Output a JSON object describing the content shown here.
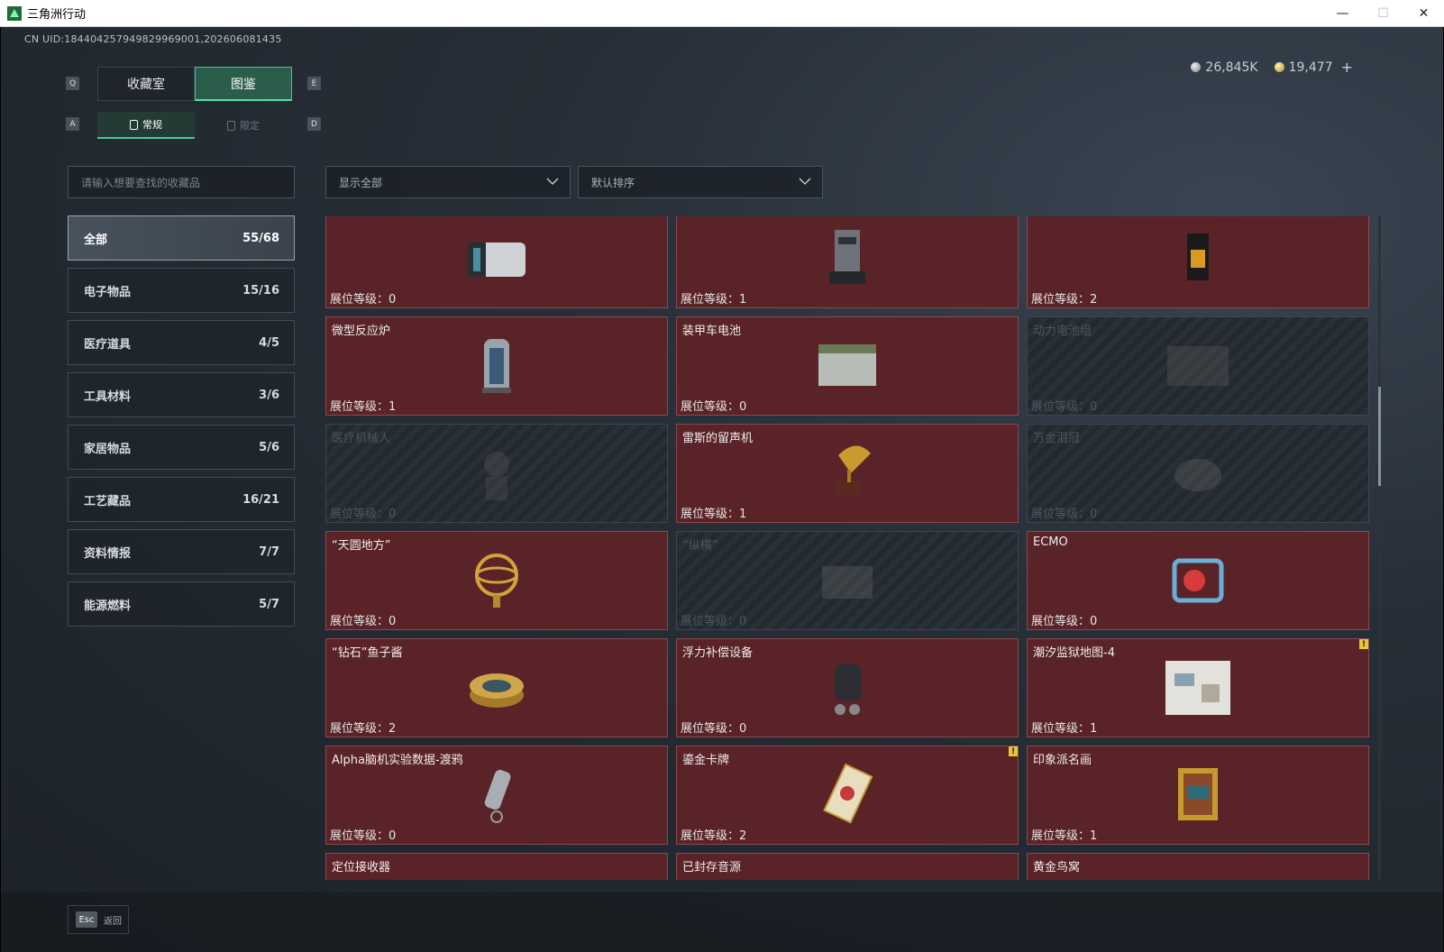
{
  "window": {
    "title": "三角洲行动",
    "minimize": "—",
    "maximize": "☐",
    "close": "✕"
  },
  "uid": "CN UID:184404257949829969001,202606081435",
  "currency": {
    "silver": "26,845K",
    "gold": "19,477",
    "plus": "+"
  },
  "keys": {
    "prev_tab": "Q",
    "next_tab": "E",
    "prev_sub": "A",
    "next_sub": "D"
  },
  "tabs_primary": [
    {
      "label": "收藏室",
      "active": false
    },
    {
      "label": "图鉴",
      "active": true
    }
  ],
  "tabs_secondary": [
    {
      "label": "常规",
      "active": true
    },
    {
      "label": "限定",
      "active": false
    }
  ],
  "search": {
    "placeholder": "请输入想要查找的收藏品"
  },
  "filter": {
    "value": "显示全部"
  },
  "sort": {
    "value": "默认排序"
  },
  "categories": [
    {
      "label": "全部",
      "count": "55/68",
      "active": true
    },
    {
      "label": "电子物品",
      "count": "15/16"
    },
    {
      "label": "医疗道具",
      "count": "4/5"
    },
    {
      "label": "工具材料",
      "count": "3/6"
    },
    {
      "label": "家居物品",
      "count": "5/6"
    },
    {
      "label": "工艺藏品",
      "count": "16/21"
    },
    {
      "label": "资料情报",
      "count": "7/7"
    },
    {
      "label": "能源燃料",
      "count": "5/7"
    }
  ],
  "level_prefix": "展位等级：",
  "items": [
    {
      "name": "",
      "level": "展位等级：0",
      "locked": false,
      "icon": "camera-icon"
    },
    {
      "name": "",
      "level": "展位等级：1",
      "locked": false,
      "icon": "machine-icon"
    },
    {
      "name": "",
      "level": "展位等级：2",
      "locked": false,
      "icon": "coffee-bag-icon"
    },
    {
      "name": "微型反应炉",
      "level": "展位等级：1",
      "locked": false,
      "icon": "reactor-icon"
    },
    {
      "name": "装甲车电池",
      "level": "展位等级：0",
      "locked": false,
      "icon": "battery-icon"
    },
    {
      "name": "动力电池组",
      "level": "展位等级：0",
      "locked": true,
      "icon": "battery-pack-icon"
    },
    {
      "name": "医疗机械人",
      "level": "展位等级：0",
      "locked": true,
      "icon": "robot-icon"
    },
    {
      "name": "雷斯的留声机",
      "level": "展位等级：1",
      "locked": false,
      "icon": "gramophone-icon"
    },
    {
      "name": "万金泪冠",
      "level": "展位等级：0",
      "locked": true,
      "icon": "crown-icon"
    },
    {
      "name": "“天圆地方”",
      "level": "展位等级：0",
      "locked": false,
      "icon": "armillary-icon"
    },
    {
      "name": "“纵横”",
      "level": "展位等级：0",
      "locked": true,
      "icon": "chessboard-icon"
    },
    {
      "name": "ECMO",
      "level": "展位等级：0",
      "locked": false,
      "icon": "ecmo-icon"
    },
    {
      "name": "“钻石”鱼子酱",
      "level": "展位等级：2",
      "locked": false,
      "icon": "caviar-icon"
    },
    {
      "name": "浮力补偿设备",
      "level": "展位等级：0",
      "locked": false,
      "icon": "bcd-icon"
    },
    {
      "name": "潮汐监狱地图-4",
      "level": "展位等级：1",
      "locked": false,
      "icon": "map-icon",
      "badge": "!"
    },
    {
      "name": "Alpha脑机实验数据-渡鸦",
      "level": "展位等级：0",
      "locked": false,
      "icon": "usb-drive-icon"
    },
    {
      "name": "鎏金卡牌",
      "level": "展位等级：2",
      "locked": false,
      "icon": "card-icon",
      "badge": "!"
    },
    {
      "name": "印象派名画",
      "level": "展位等级：1",
      "locked": false,
      "icon": "painting-icon"
    },
    {
      "name": "定位接收器",
      "level": "",
      "locked": false,
      "icon": "receiver-icon"
    },
    {
      "name": "已封存音源",
      "level": "",
      "locked": false,
      "icon": "tape-reel-icon"
    },
    {
      "name": "黄金鸟窝",
      "level": "",
      "locked": false,
      "icon": "gold-nest-icon"
    }
  ],
  "footer": {
    "esc": "Esc",
    "back": "返回"
  }
}
